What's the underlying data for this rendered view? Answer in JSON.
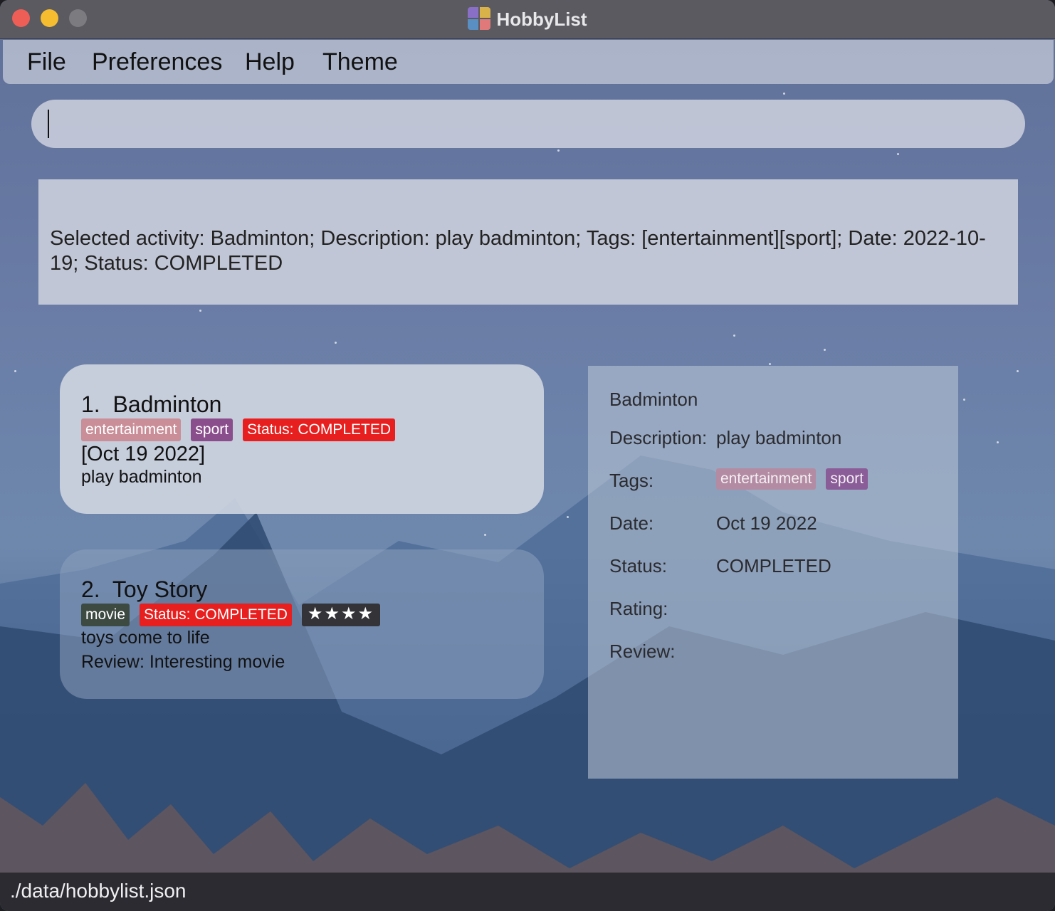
{
  "window": {
    "title": "HobbyList"
  },
  "menu": [
    "File",
    "Preferences",
    "Help",
    "Theme"
  ],
  "command": {
    "value": "",
    "placeholder": ""
  },
  "result": {
    "text": "Selected activity: Badminton; Description: play badminton; Tags: [entertainment][sport]; Date: 2022-10-19; Status: COMPLETED"
  },
  "activities": [
    {
      "index": "1.",
      "name": "Badminton",
      "tags": [
        "entertainment",
        "sport"
      ],
      "status": "Status: COMPLETED",
      "date": "[Oct 19 2022]",
      "description": "play badminton"
    },
    {
      "index": "2.",
      "name": "Toy Story",
      "tags": [
        "movie"
      ],
      "status": "Status: COMPLETED",
      "rating": "★★★★",
      "description": "toys come to life",
      "review": "Review: Interesting movie"
    }
  ],
  "detail": {
    "name": "Badminton",
    "labels": {
      "description": "Description:",
      "tags": "Tags:",
      "date": "Date:",
      "status": "Status:",
      "rating": "Rating:",
      "review": "Review:"
    },
    "description": "play badminton",
    "tags": [
      "entertainment",
      "sport"
    ],
    "date": "Oct 19 2022",
    "status": "COMPLETED",
    "rating": "",
    "review": ""
  },
  "statusbar": {
    "path": "./data/hobbylist.json"
  },
  "colors": {
    "tag_entertainment": "#c98e98",
    "tag_sport": "#8b4e8c",
    "tag_status": "#e71f1f",
    "tag_movie": "#3d4a42"
  }
}
